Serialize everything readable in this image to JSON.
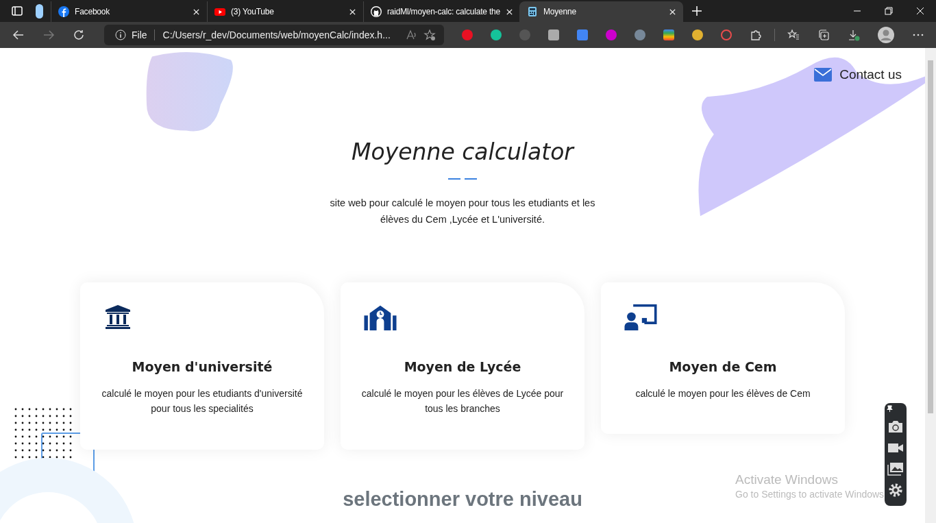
{
  "browser": {
    "tabs": [
      {
        "title": "Facebook",
        "selected": false
      },
      {
        "title": "(3) YouTube",
        "selected": false
      },
      {
        "title": "raidMl/moyen-calc: calculate the",
        "selected": false
      },
      {
        "title": "Moyenne",
        "selected": true
      }
    ],
    "address_label": "File",
    "address": "C:/Users/r_dev/Documents/web/moyenCalc/index.h..."
  },
  "page": {
    "contact": "Contact us",
    "title": "Moyenne calculator",
    "description": "site web pour calculé le moyen pour tous les etudiants et les élèves du Cem ,Lycée et L'université.",
    "cards": [
      {
        "title": "Moyen d'université",
        "text": "calculé le moyen pour les etudiants d'université pour tous les specialités"
      },
      {
        "title": "Moyen de Lycée",
        "text": "calculé le moyen pour les élèves de Lycée pour tous les branches"
      },
      {
        "title": "Moyen de Cem",
        "text": "calculé le moyen pour les élèves de Cem"
      }
    ],
    "section_title": "selectionner votre niveau"
  },
  "os_notice": {
    "title": "Activate Windows",
    "text": "Go to Settings to activate Windows"
  }
}
